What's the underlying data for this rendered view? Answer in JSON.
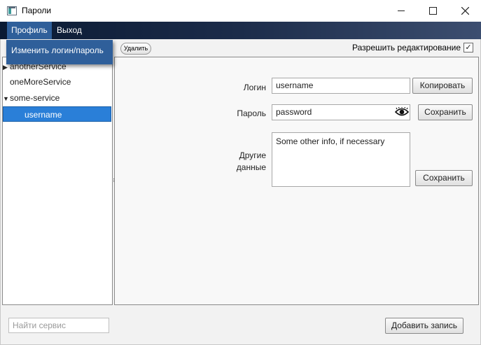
{
  "window": {
    "title": "Пароли",
    "icon": "app-window-icon"
  },
  "menu": {
    "profile": "Профиль",
    "exit": "Выход",
    "dropdown_item": "Изменить логин/пароль"
  },
  "toolbar": {
    "delete_label": "Удалить",
    "edit_label": "Разрешить редактирование",
    "edit_checked": true,
    "check_glyph": "✓"
  },
  "tree": {
    "items": [
      {
        "label": "anotherService",
        "arrow": "▶",
        "expanded": false
      },
      {
        "label": "oneMoreService",
        "arrow": ""
      },
      {
        "label": "some-service",
        "arrow": "▼",
        "expanded": true
      },
      {
        "label": "username",
        "arrow": "",
        "selected": true
      }
    ]
  },
  "details": {
    "login_label": "Логин",
    "login_value": "username",
    "password_label": "Пароль",
    "password_value": "password",
    "other_label": "Другие данные",
    "other_value": "Some other info, if necessary",
    "copy_button": "Копировать",
    "save_password_button": "Сохранить",
    "save_other_button": "Сохранить"
  },
  "bottom": {
    "search_placeholder": "Найти сервис",
    "add_button": "Добавить запись"
  },
  "colors": {
    "selection": "#2a7fd8",
    "menu_bar_start": "#0a1a33",
    "menu_bar_end": "#3c4e70",
    "menu_active": "#2f5f9a"
  }
}
